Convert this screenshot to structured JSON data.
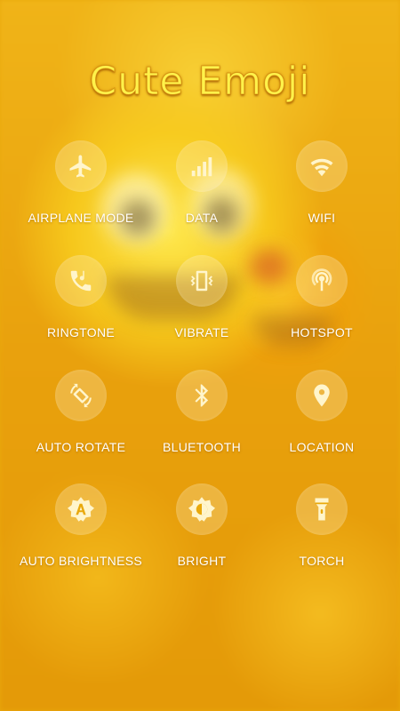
{
  "header": {
    "title": "Cute Emoji"
  },
  "toggles": [
    {
      "label": "AIRPLANE MODE",
      "icon": "airplane-icon"
    },
    {
      "label": "DATA",
      "icon": "signal-bars-icon"
    },
    {
      "label": "WIFI",
      "icon": "wifi-icon"
    },
    {
      "label": "RINGTONE",
      "icon": "phone-ring-icon"
    },
    {
      "label": "VIBRATE",
      "icon": "vibrate-icon"
    },
    {
      "label": "HOTSPOT",
      "icon": "hotspot-icon"
    },
    {
      "label": "AUTO ROTATE",
      "icon": "auto-rotate-icon"
    },
    {
      "label": "BLUETOOTH",
      "icon": "bluetooth-icon"
    },
    {
      "label": "LOCATION",
      "icon": "location-pin-icon"
    },
    {
      "label": "AUTO BRIGHTNESS",
      "icon": "auto-brightness-icon"
    },
    {
      "label": "BRIGHT",
      "icon": "brightness-icon"
    },
    {
      "label": "TORCH",
      "icon": "torch-icon"
    }
  ],
  "colors": {
    "background": "#e9a90c",
    "title": "#fff24a",
    "icon": "#fff5cc",
    "label": "#ffffff"
  }
}
